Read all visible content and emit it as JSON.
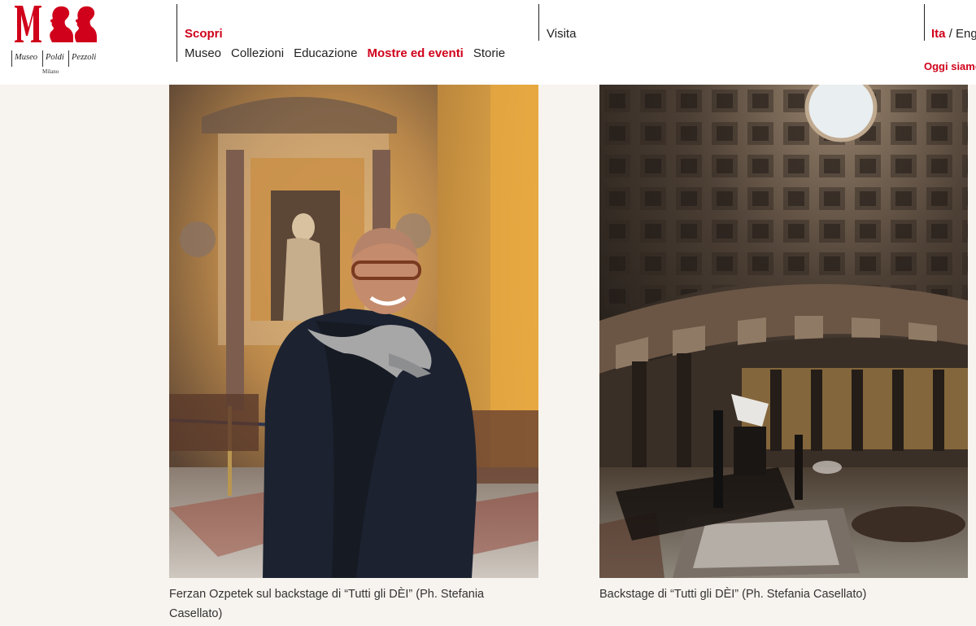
{
  "logo": {
    "words": [
      "Museo",
      "Poldi",
      "Pezzoli"
    ],
    "city": "Milano"
  },
  "nav": {
    "scopri": "Scopri",
    "visita": "Visita",
    "subnav": [
      {
        "label": "Museo",
        "active": false
      },
      {
        "label": "Collezioni",
        "active": false
      },
      {
        "label": "Educazione",
        "active": false
      },
      {
        "label": "Mostre ed eventi",
        "active": true
      },
      {
        "label": "Storie",
        "active": false
      }
    ]
  },
  "language": {
    "current": "Ita",
    "separator": "/",
    "other": "Eng"
  },
  "status": "Oggi siamo",
  "gallery": [
    {
      "caption": "Ferzan Ozpetek sul backstage di “Tutti gli DÈI” (Ph. Stefania Casellato)"
    },
    {
      "caption": "Backstage di “Tutti gli DÈI” (Ph. Stefania Casellato)"
    }
  ],
  "colors": {
    "accent": "#d0021b",
    "page_background": "#f7f3ee",
    "header_background": "#ffffff"
  }
}
